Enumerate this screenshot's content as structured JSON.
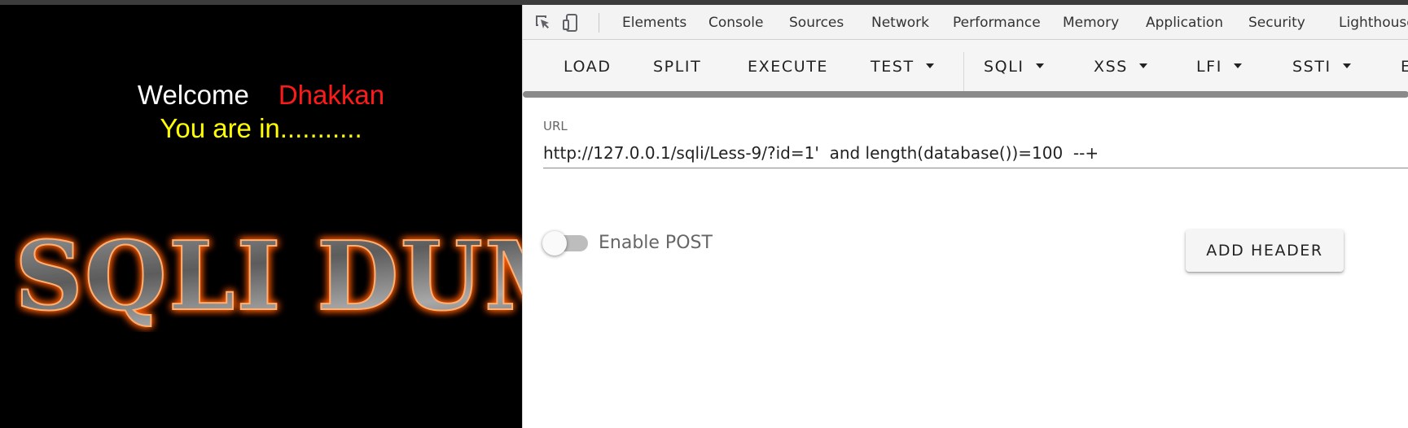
{
  "page": {
    "welcome": "Welcome",
    "name": "Dhakkan",
    "status": "You are in...........",
    "banner_text": "SQLI DUMB SERIES"
  },
  "devtools": {
    "tabs": [
      "Elements",
      "Console",
      "Sources",
      "Network",
      "Performance",
      "Memory",
      "Application",
      "Security",
      "Lighthouse"
    ],
    "toolbar": {
      "load": "LOAD",
      "split": "SPLIT",
      "execute": "EXECUTE",
      "test": "TEST",
      "sqli": "SQLI",
      "xss": "XSS",
      "lfi": "LFI",
      "ssti": "SSTI",
      "more": "ENCRYPTION"
    },
    "url_label": "URL",
    "url_value": "http://127.0.0.1/sqli/Less-9/?id=1'  and length(database())=100  --+",
    "enable_post_label": "Enable POST",
    "enable_post_on": false,
    "add_header": "ADD HEADER"
  }
}
